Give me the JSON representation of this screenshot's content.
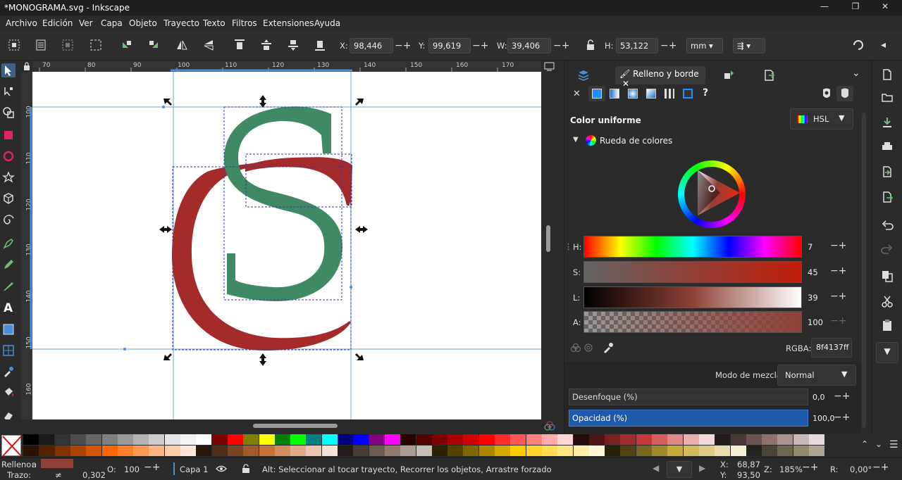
{
  "window": {
    "title": "*MONOGRAMA.svg - Inkscape",
    "minimize": "—",
    "maximize": "❐",
    "close": "✕"
  },
  "menu": [
    "Archivo",
    "Edición",
    "Ver",
    "Capa",
    "Objeto",
    "Trayecto",
    "Texto",
    "Filtros",
    "Extensiones",
    "Ayuda"
  ],
  "toolbar": {
    "x_label": "X:",
    "x_value": "98,446",
    "y_label": "Y:",
    "y_value": "99,619",
    "w_label": "W:",
    "w_value": "39,406",
    "h_label": "H:",
    "h_value": "53,122",
    "unit": "mm"
  },
  "ruler": {
    "top": [
      "70",
      "80",
      "90",
      "100",
      "110",
      "120",
      "130",
      "140",
      "150",
      "160",
      "170"
    ],
    "left": [
      "100",
      "110",
      "120",
      "130",
      "140",
      "150",
      "160"
    ]
  },
  "canvas": {
    "s_color": "#3f8a64",
    "c_color": "#a52a2a"
  },
  "panel": {
    "tab_label": "Relleno y borde",
    "tab_close": "✕",
    "paint_unset": "✕",
    "paint_unknown": "?",
    "section_title": "Color uniforme",
    "color_mode": "HSL",
    "wheel_label": "Rueda de colores",
    "sliders": [
      {
        "letter": "H:",
        "value": "7"
      },
      {
        "letter": "S:",
        "value": "45"
      },
      {
        "letter": "L:",
        "value": "39"
      },
      {
        "letter": "A:",
        "value": "100"
      }
    ],
    "rgba_label": "RGBA:",
    "rgba_value": "8f4137ff",
    "blend_label": "Modo de mezcla:",
    "blend_value": "Normal",
    "blur_label": "Desenfoque (%)",
    "blur_value": "0,0",
    "opacity_label": "Opacidad (%)",
    "opacity_value": "100,0",
    "accent": "#1e5aa8"
  },
  "status": {
    "fill_label": "Relleno:",
    "fill_flag": "a",
    "fill_color": "#8f4137",
    "stroke_label": "Trazo:",
    "stroke_flag": "≠",
    "stroke_width": "0,302",
    "opacity_label": "O:",
    "opacity_value": "100",
    "layer": "Capa 1",
    "message": "Alt: Seleccionar al tocar trayecto, Recorrer los objetos, Arrastre forzado",
    "cursor_x_label": "X:",
    "cursor_x": "68,87",
    "cursor_y_label": "Y:",
    "cursor_y": "93,50",
    "zoom_label": "Z:",
    "zoom": "185%",
    "rotate_label": "R:",
    "rotation": "0,00°"
  }
}
